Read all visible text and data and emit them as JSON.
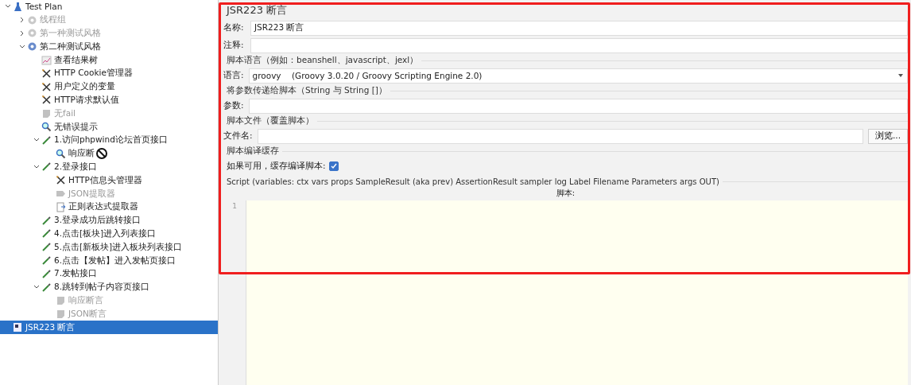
{
  "tree": [
    {
      "label": "Test Plan",
      "kind": "plan",
      "expanded": true,
      "disabled": false,
      "selected": false,
      "children": [
        {
          "label": "线程组",
          "kind": "thread",
          "expanded": false,
          "disabled": true,
          "selected": false
        },
        {
          "label": "第一种测试风格",
          "kind": "thread",
          "expanded": false,
          "disabled": true,
          "selected": false
        },
        {
          "label": "第二种测试风格",
          "kind": "thread-active",
          "expanded": true,
          "disabled": false,
          "selected": false,
          "children": [
            {
              "label": "查看结果树",
              "kind": "listener",
              "disabled": false,
              "selected": false
            },
            {
              "label": "HTTP Cookie管理器",
              "kind": "config",
              "disabled": false,
              "selected": false
            },
            {
              "label": "用户定义的变量",
              "kind": "config",
              "disabled": false,
              "selected": false
            },
            {
              "label": "HTTP请求默认值",
              "kind": "config",
              "disabled": false,
              "selected": false
            },
            {
              "label": "无fail",
              "kind": "assertion",
              "disabled": true,
              "selected": false
            },
            {
              "label": "无错误提示",
              "kind": "search",
              "disabled": false,
              "selected": false
            },
            {
              "label": "1.访问phpwind论坛首页接口",
              "kind": "sampler",
              "expanded": true,
              "disabled": false,
              "selected": false,
              "children": [
                {
                  "label": "响应断",
                  "kind": "search",
                  "disabled": false,
                  "selected": false,
                  "cursor": true
                }
              ]
            },
            {
              "label": "2.登录接口",
              "kind": "sampler",
              "expanded": true,
              "disabled": false,
              "selected": false,
              "children": [
                {
                  "label": "HTTP信息头管理器",
                  "kind": "config",
                  "disabled": false,
                  "selected": false
                },
                {
                  "label": "JSON提取器",
                  "kind": "extractor",
                  "disabled": true,
                  "selected": false
                },
                {
                  "label": "正则表达式提取器",
                  "kind": "regex",
                  "disabled": false,
                  "selected": false
                }
              ]
            },
            {
              "label": "3.登录成功后跳转接口",
              "kind": "sampler",
              "disabled": false,
              "selected": false
            },
            {
              "label": "4.点击[板块]进入列表接口",
              "kind": "sampler",
              "disabled": false,
              "selected": false
            },
            {
              "label": "5.点击[新板块]进入板块列表接口",
              "kind": "sampler",
              "disabled": false,
              "selected": false
            },
            {
              "label": "6.点击【发帖】进入发帖页接口",
              "kind": "sampler",
              "disabled": false,
              "selected": false
            },
            {
              "label": "7.发帖接口",
              "kind": "sampler",
              "disabled": false,
              "selected": false
            },
            {
              "label": "8.跳转到帖子内容页接口",
              "kind": "sampler",
              "expanded": true,
              "disabled": false,
              "selected": false,
              "children": [
                {
                  "label": "响应断言",
                  "kind": "assertion",
                  "disabled": true,
                  "selected": false
                },
                {
                  "label": "JSON断言",
                  "kind": "assertion",
                  "disabled": true,
                  "selected": false
                }
              ]
            }
          ]
        }
      ]
    },
    {
      "label": "JSR223 断言",
      "kind": "jsr",
      "disabled": false,
      "selected": true
    }
  ],
  "panel": {
    "title": "JSR223 断言",
    "name": {
      "label": "名称:",
      "value": "JSR223 断言"
    },
    "comment": {
      "label": "注释:"
    },
    "language_section": "脚本语言（例如：beanshell、javascript、jexl）",
    "language": {
      "label": "语言:",
      "value": "groovy",
      "detail": "(Groovy 3.0.20 / Groovy Scripting Engine 2.0)"
    },
    "params_section": "将参数传递给脚本（String 与 String []）",
    "params": {
      "label": "参数:"
    },
    "file_section": "脚本文件（覆盖脚本）",
    "file": {
      "label": "文件名:",
      "button": "浏览..."
    },
    "cache_section": "脚本编译缓存",
    "cache": {
      "label": "如果可用，缓存编译脚本:",
      "checked": true
    },
    "script_section": "Script (variables: ctx vars props SampleResult (aka prev) AssertionResult sampler log Label Filename Parameters args OUT)",
    "script_label": "脚本:",
    "line_numbers": [
      "1"
    ]
  },
  "highlight": {
    "on": true
  }
}
